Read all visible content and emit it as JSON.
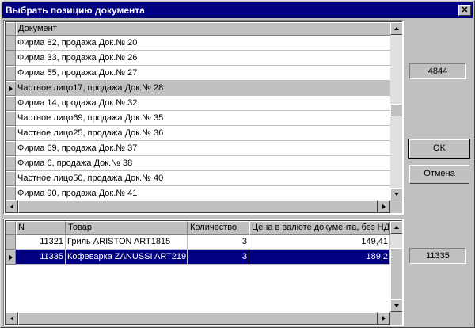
{
  "window": {
    "title": "Выбрать позицию документа",
    "close_glyph": "✕"
  },
  "documents": {
    "header": "Документ",
    "rows": [
      "Фирма 82, продажа Док.№ 20",
      "Фирма 33, продажа Док.№ 26",
      "Фирма 55, продажа Док.№ 27",
      "Частное лицо17, продажа Док.№ 28",
      "Фирма 14, продажа Док.№ 32",
      "Частное лицо69, продажа Док.№ 35",
      "Частное лицо25, продажа Док.№ 36",
      "Фирма 69, продажа Док.№ 37",
      "Фирма 6, продажа Док.№ 38",
      "Частное лицо50, продажа Док.№ 40",
      "Фирма 90, продажа Док.№ 41"
    ],
    "selected_index": 3
  },
  "items": {
    "headers": {
      "n": "N",
      "product": "Товар",
      "qty": "Количество",
      "price": "Цена в валюте документа, без НДС"
    },
    "rows": [
      {
        "n": "11321",
        "product": "Гриль ARISTON ART1815",
        "qty": "3",
        "price": "149,41"
      },
      {
        "n": "11335",
        "product": "Кофеварка ZANUSSI ART219",
        "qty": "3",
        "price": "189,2"
      }
    ],
    "selected_index": 1
  },
  "side": {
    "doc_value": "4844",
    "item_value": "11335",
    "ok_label": "OK",
    "cancel_label": "Отмена"
  }
}
